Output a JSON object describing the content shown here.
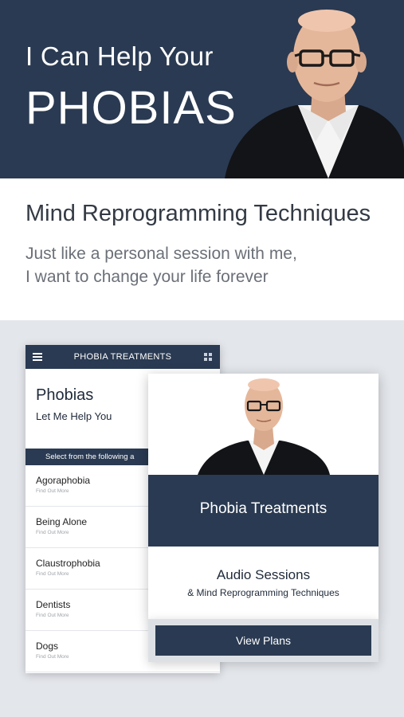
{
  "hero": {
    "line1": "I Can Help Your",
    "line2": "PHOBIAS"
  },
  "band": {
    "heading": "Mind Reprogramming Techniques",
    "subtitle_line1": "Just like a personal session with me,",
    "subtitle_line2": "I want to change your life forever"
  },
  "phone_back": {
    "topbar_title": "PHOBIA TREATMENTS",
    "menu_icon": "hamburger-icon",
    "grid_icon": "grid-icon",
    "header_title": "Phobias",
    "header_subtitle": "Let Me Help You",
    "select_text": "Select from the following a",
    "items": [
      {
        "name": "Agoraphobia",
        "sub": "Find Out More"
      },
      {
        "name": "Being Alone",
        "sub": "Find Out More"
      },
      {
        "name": "Claustrophobia",
        "sub": "Find Out More"
      },
      {
        "name": "Dentists",
        "sub": "Find Out More"
      },
      {
        "name": "Dogs",
        "sub": "Find Out More"
      }
    ]
  },
  "card": {
    "navy_title": "Phobia Treatments",
    "audio_title": "Audio Sessions",
    "audio_subtitle": "& Mind Reprogramming Techniques",
    "button_label": "View Plans"
  },
  "colors": {
    "navy": "#2a3a52",
    "background_gray": "#e3e6eb",
    "white": "#ffffff"
  }
}
